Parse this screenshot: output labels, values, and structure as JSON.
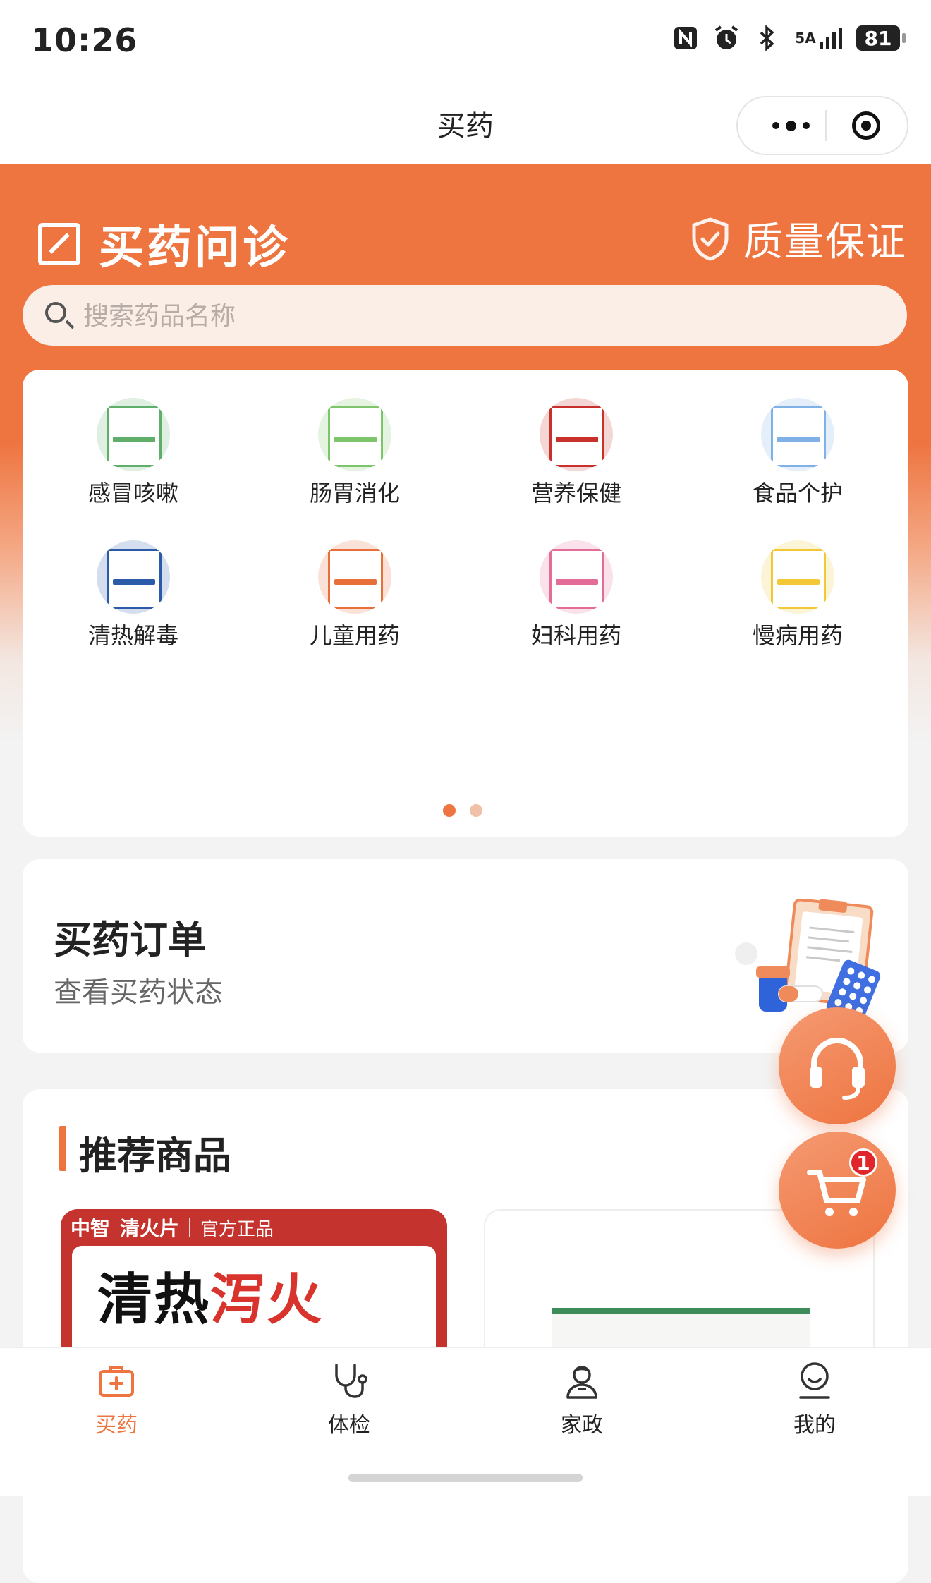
{
  "status_bar": {
    "time": "10:26",
    "network": "5A",
    "battery": "81"
  },
  "nav": {
    "title": "买药"
  },
  "hero": {
    "brand_title": "买药问诊",
    "quality_label": "质量保证"
  },
  "search": {
    "placeholder": "搜索药品名称"
  },
  "categories": [
    {
      "label": "感冒咳嗽",
      "color": "#5fae6a"
    },
    {
      "label": "肠胃消化",
      "color": "#7ec46a"
    },
    {
      "label": "营养保健",
      "color": "#c8302b"
    },
    {
      "label": "食品个护",
      "color": "#7fb0e6"
    },
    {
      "label": "清热解毒",
      "color": "#2b5aa8"
    },
    {
      "label": "儿童用药",
      "color": "#e86e3a"
    },
    {
      "label": "妇科用药",
      "color": "#e36d98"
    },
    {
      "label": "慢病用药",
      "color": "#f2c836"
    }
  ],
  "pager": {
    "active": 0,
    "total": 2
  },
  "orders": {
    "title": "买药订单",
    "subtitle": "查看买药状态"
  },
  "recommend": {
    "title": "推荐商品",
    "product1": {
      "brand": "中智",
      "name": "清火片",
      "official": "官方正品",
      "slogan_part1": "清热",
      "slogan_part2": "泻火"
    }
  },
  "cart": {
    "badge": "1"
  },
  "tabs": [
    {
      "label": "买药",
      "icon": "medicine-kit-icon",
      "active": true
    },
    {
      "label": "体检",
      "icon": "stethoscope-icon",
      "active": false
    },
    {
      "label": "家政",
      "icon": "housekeeper-icon",
      "active": false
    },
    {
      "label": "我的",
      "icon": "profile-icon",
      "active": false
    }
  ],
  "colors": {
    "accent": "#ee7440",
    "badge": "#e0262b"
  }
}
